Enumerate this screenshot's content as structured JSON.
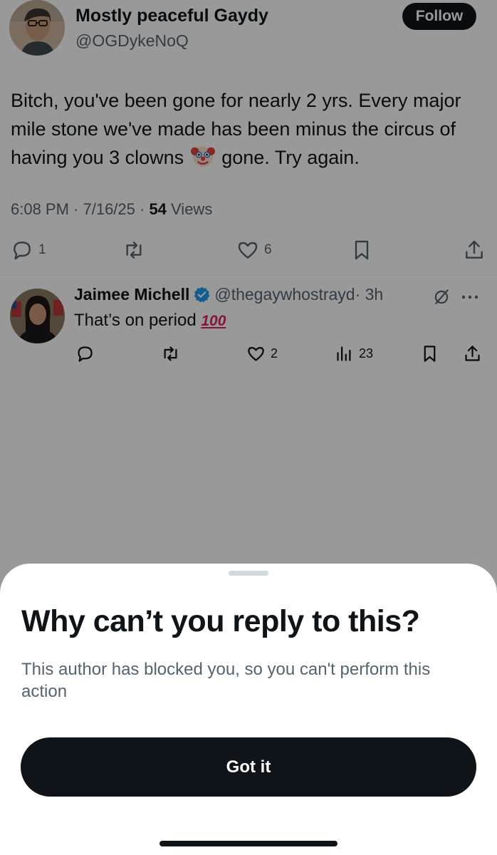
{
  "tweet": {
    "author_name": "Mostly peaceful Gaydy",
    "author_handle": "@OGDykeNoQ",
    "follow_label": "Follow",
    "text_part1": "Bitch, you've been gone for nearly 2 yrs. Every major mile stone we've made has been minus the circus of having you 3 clowns",
    "text_emoji": "clown-face-emoji",
    "text_part2": "gone. Try again.",
    "time_date": "6:08 PM · 7/16/25 · ",
    "views_count": "54",
    "views_label": " Views",
    "replies": "1",
    "likes": "6"
  },
  "reply": {
    "author_name": "Jaimee Michell",
    "author_handle": "@thegaywhostrayd",
    "time": " · 3h",
    "text": "That’s on period ",
    "emoji_text": "100",
    "likes": "2",
    "views": "23"
  },
  "sheet": {
    "title": "Why can’t you reply to this?",
    "body": "This author has blocked you, so you can't perform this action",
    "button_label": "Got it"
  },
  "colors": {
    "text_primary": "#0f1419",
    "text_secondary": "#536471",
    "verified_blue": "#1d9bf0",
    "overlay": "rgba(0,0,0,0.40)"
  },
  "icons": [
    "reply-icon",
    "retweet-icon",
    "like-icon",
    "bookmark-icon",
    "share-icon",
    "views-icon",
    "verified-badge-icon",
    "grok-icon",
    "more-icon",
    "clown-face-emoji"
  ]
}
